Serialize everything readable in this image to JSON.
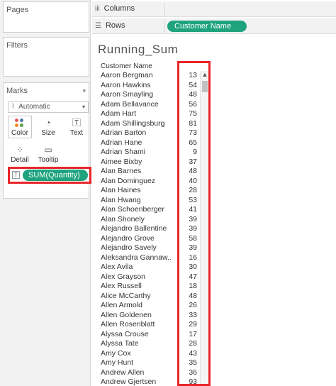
{
  "left_pane": {
    "pages_title": "Pages",
    "filters_title": "Filters",
    "marks_title": "Marks",
    "mark_type": "Automatic",
    "buttons": {
      "color": "Color",
      "size": "Size",
      "text": "Text",
      "detail": "Detail",
      "tooltip": "Tooltip"
    },
    "measure_pill": "SUM(Quantity)"
  },
  "shelves": {
    "columns_label": "Columns",
    "rows_label": "Rows",
    "rows_pill": "Customer Name"
  },
  "view": {
    "title": "Running_Sum",
    "column_header": "Customer Name",
    "rows": [
      {
        "name": "Aaron Bergman",
        "value": "13"
      },
      {
        "name": "Aaron Hawkins",
        "value": "54"
      },
      {
        "name": "Aaron Smayling",
        "value": "48"
      },
      {
        "name": "Adam Bellavance",
        "value": "56"
      },
      {
        "name": "Adam Hart",
        "value": "75"
      },
      {
        "name": "Adam Shillingsburg",
        "value": "81"
      },
      {
        "name": "Adrian Barton",
        "value": "73"
      },
      {
        "name": "Adrian Hane",
        "value": "65"
      },
      {
        "name": "Adrian Shami",
        "value": "9"
      },
      {
        "name": "Aimee Bixby",
        "value": "37"
      },
      {
        "name": "Alan Barnes",
        "value": "48"
      },
      {
        "name": "Alan Dominguez",
        "value": "40"
      },
      {
        "name": "Alan Haines",
        "value": "28"
      },
      {
        "name": "Alan Hwang",
        "value": "53"
      },
      {
        "name": "Alan Schoenberger",
        "value": "41"
      },
      {
        "name": "Alan Shonely",
        "value": "39"
      },
      {
        "name": "Alejandro Ballentine",
        "value": "39"
      },
      {
        "name": "Alejandro Grove",
        "value": "58"
      },
      {
        "name": "Alejandro Savely",
        "value": "39"
      },
      {
        "name": "Aleksandra Gannaw..",
        "value": "16"
      },
      {
        "name": "Alex Avila",
        "value": "30"
      },
      {
        "name": "Alex Grayson",
        "value": "47"
      },
      {
        "name": "Alex Russell",
        "value": "18"
      },
      {
        "name": "Alice McCarthy",
        "value": "48"
      },
      {
        "name": "Allen Armold",
        "value": "26"
      },
      {
        "name": "Allen Goldenen",
        "value": "33"
      },
      {
        "name": "Allen Rosenblatt",
        "value": "29"
      },
      {
        "name": "Alyssa Crouse",
        "value": "17"
      },
      {
        "name": "Alyssa Tate",
        "value": "28"
      },
      {
        "name": "Amy Cox",
        "value": "43"
      },
      {
        "name": "Amy Hunt",
        "value": "35"
      },
      {
        "name": "Andrew Allen",
        "value": "36"
      },
      {
        "name": "Andrew Gjertsen",
        "value": "93"
      }
    ]
  },
  "colors": {
    "pill": "#1fa37f",
    "highlight": "#e8262a"
  }
}
